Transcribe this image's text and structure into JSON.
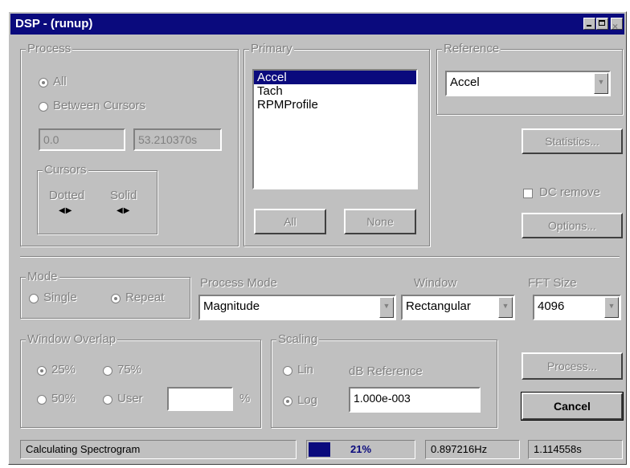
{
  "window": {
    "title": "DSP - (runup)"
  },
  "process": {
    "label": "Process",
    "all_label": "All",
    "between_label": "Between Cursors",
    "start_value": "0.0",
    "end_value": "53.210370s",
    "cursors": {
      "label": "Cursors",
      "dotted": "Dotted",
      "solid": "Solid"
    }
  },
  "primary": {
    "label": "Primary",
    "items": [
      "Accel",
      "Tach",
      "RPMProfile"
    ],
    "selected": "Accel",
    "all_button": "All",
    "none_button": "None"
  },
  "reference": {
    "label": "Reference",
    "value": "Accel"
  },
  "statistics_button": "Statistics...",
  "dc_remove_label": "DC remove",
  "options_button": "Options...",
  "mode": {
    "label": "Mode",
    "single": "Single",
    "repeat": "Repeat",
    "selected": "Repeat"
  },
  "process_mode": {
    "label": "Process Mode",
    "value": "Magnitude"
  },
  "window_fn": {
    "label": "Window",
    "value": "Rectangular"
  },
  "fft_size": {
    "label": "FFT Size",
    "value": "4096"
  },
  "overlap": {
    "label": "Window Overlap",
    "opt25": "25%",
    "opt75": "75%",
    "opt50": "50%",
    "user": "User",
    "user_value": "",
    "unit": "%",
    "selected": "25%"
  },
  "scaling": {
    "label": "Scaling",
    "lin": "Lin",
    "log": "Log",
    "db_ref_label": "dB Reference",
    "db_ref_value": "1.000e-003",
    "selected": "Log"
  },
  "process_button": "Process...",
  "cancel_button": "Cancel",
  "status": {
    "message": "Calculating Spectrogram",
    "progress_text": "21%",
    "progress": 0.21,
    "freq": "0.897216Hz",
    "time": "1.114558s"
  },
  "colors": {
    "title_bar": "#0a0a7d",
    "face": "#c0c0c0",
    "selection": "#0a0a7d"
  }
}
